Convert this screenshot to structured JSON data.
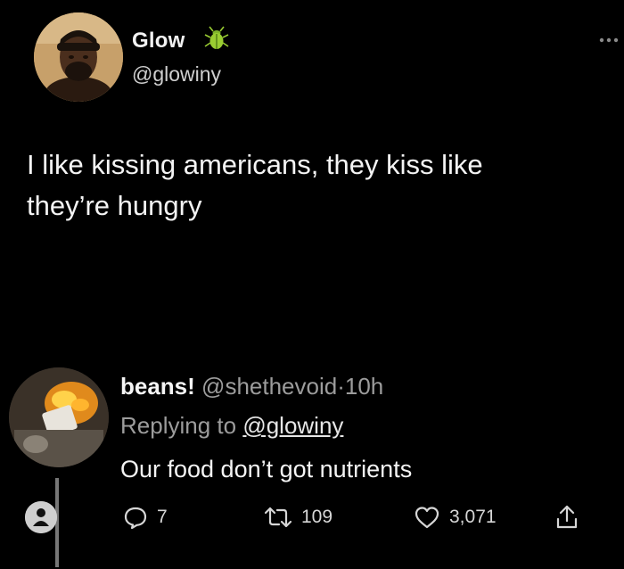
{
  "tweet": {
    "author": {
      "display_name": "Glow",
      "handle": "@glowiny",
      "avatar_icon": "avatar-man-photo",
      "badge_icon": "beetle-emoji"
    },
    "more_icon": "more-options-icon",
    "text": "I like kissing americans, they kiss like\nthey’re hungry"
  },
  "reply": {
    "author": {
      "display_name": "beans!",
      "handle": "@shethevoid",
      "separator": "·",
      "time": "10h",
      "avatar_icon": "avatar-pumpkin-photo"
    },
    "replying_prefix": "Replying to",
    "replying_to": "@glowiny",
    "text": "Our food don’t got nutrients",
    "actions": {
      "replies": "7",
      "retweets": "109",
      "likes": "3,071"
    }
  },
  "colors": {
    "background": "#000000",
    "text_primary": "#f4f4f4",
    "text_secondary": "#9c9c9c",
    "badge": "#9acd32"
  }
}
